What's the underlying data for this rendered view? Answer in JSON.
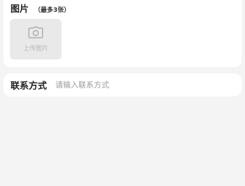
{
  "images_section": {
    "title": "图片",
    "hint": "（最多3张）",
    "upload": {
      "icon": "camera-icon",
      "label": "上传图片"
    }
  },
  "contact_section": {
    "label": "联系方式",
    "input_value": "",
    "placeholder": "请输入联系方式"
  }
}
